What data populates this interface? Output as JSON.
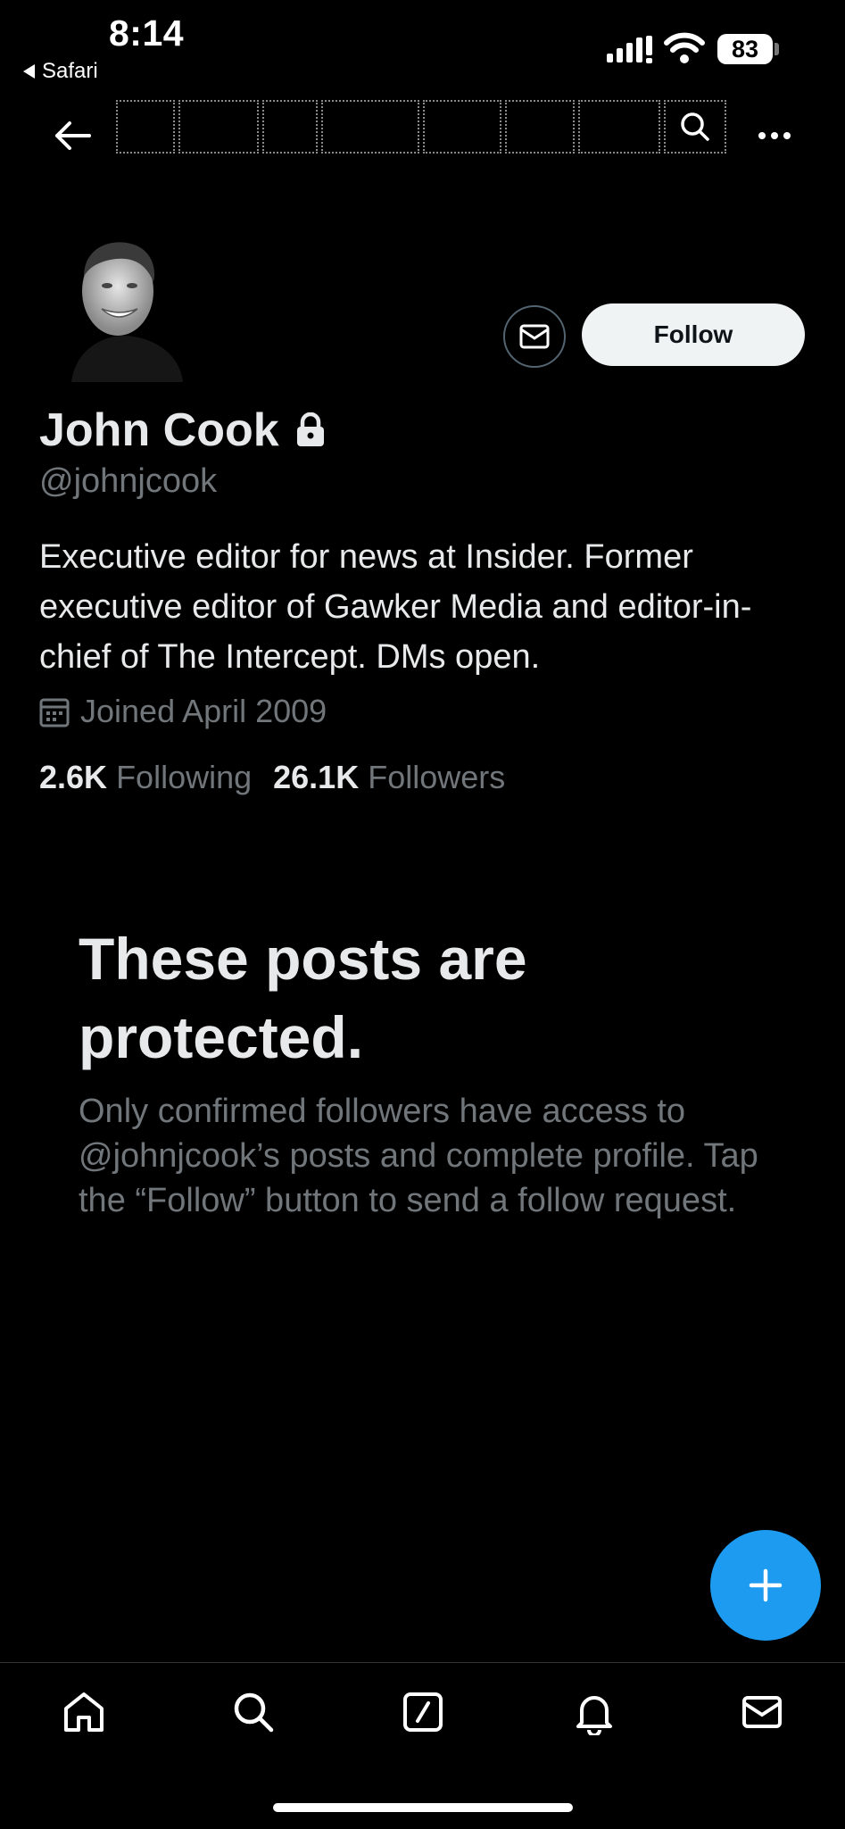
{
  "status": {
    "time": "8:14",
    "back_app": "Safari",
    "battery": "83"
  },
  "profile": {
    "name": "John Cook",
    "handle": "@johnjcook",
    "bio": "Executive editor for news at Insider. Former executive editor of Gawker Media and editor-in-chief of The Intercept. DMs open.",
    "joined": "Joined April 2009",
    "following_count": "2.6K",
    "following_label": "Following",
    "followers_count": "26.1K",
    "followers_label": "Followers",
    "follow_label": "Follow"
  },
  "protected": {
    "title": "These posts are protected.",
    "body": "Only confirmed followers have access to @johnjcook’s posts and complete profile. Tap the “Follow” button to send a follow request."
  },
  "icons": {
    "back": "arrow-left-icon",
    "search": "search-icon",
    "more": "more-icon",
    "lock": "lock-icon",
    "calendar": "calendar-icon",
    "mail": "mail-icon",
    "fab": "plus-icon",
    "tabs": [
      "home-icon",
      "search-icon",
      "compose-icon",
      "bell-icon",
      "mail-icon"
    ]
  },
  "colors": {
    "accent": "#1d9bf0",
    "text": "#e7e9ea",
    "secondary": "#71767b",
    "background": "#000000"
  }
}
